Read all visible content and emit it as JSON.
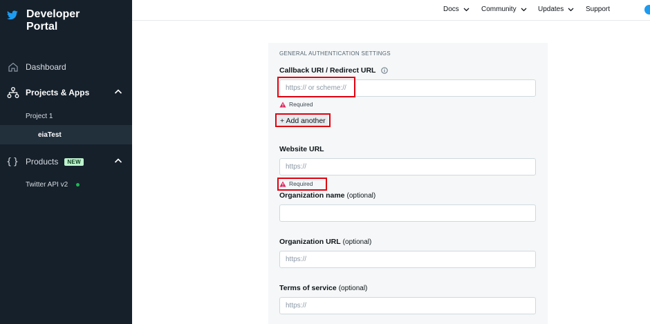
{
  "sidebar": {
    "brand_title": "Developer Portal",
    "dashboard": "Dashboard",
    "projects_apps": "Projects & Apps",
    "project": "Project 1",
    "app": "eiaTest",
    "products": "Products",
    "products_badge": "NEW",
    "twitter_api": "Twitter API v2"
  },
  "topnav": {
    "docs": "Docs",
    "community": "Community",
    "updates": "Updates",
    "support": "Support"
  },
  "form": {
    "section_heading": "GENERAL AUTHENTICATION SETTINGS",
    "callback_label": "Callback URI / Redirect URL",
    "callback_placeholder": "https:// or scheme://",
    "required_text": "Required",
    "add_another": "+ Add another",
    "website_label": "Website URL",
    "website_placeholder": "https://",
    "org_name_label": "Organization name",
    "optional_text": "(optional)",
    "org_url_label": "Organization URL",
    "org_url_placeholder": "https://",
    "tos_label": "Terms of service",
    "tos_placeholder": "https://"
  },
  "colors": {
    "sidebar_bg": "#15202b",
    "twitter_blue": "#1d9bf0",
    "highlight_red": "#e0000f",
    "warning_red": "#e0245e"
  }
}
